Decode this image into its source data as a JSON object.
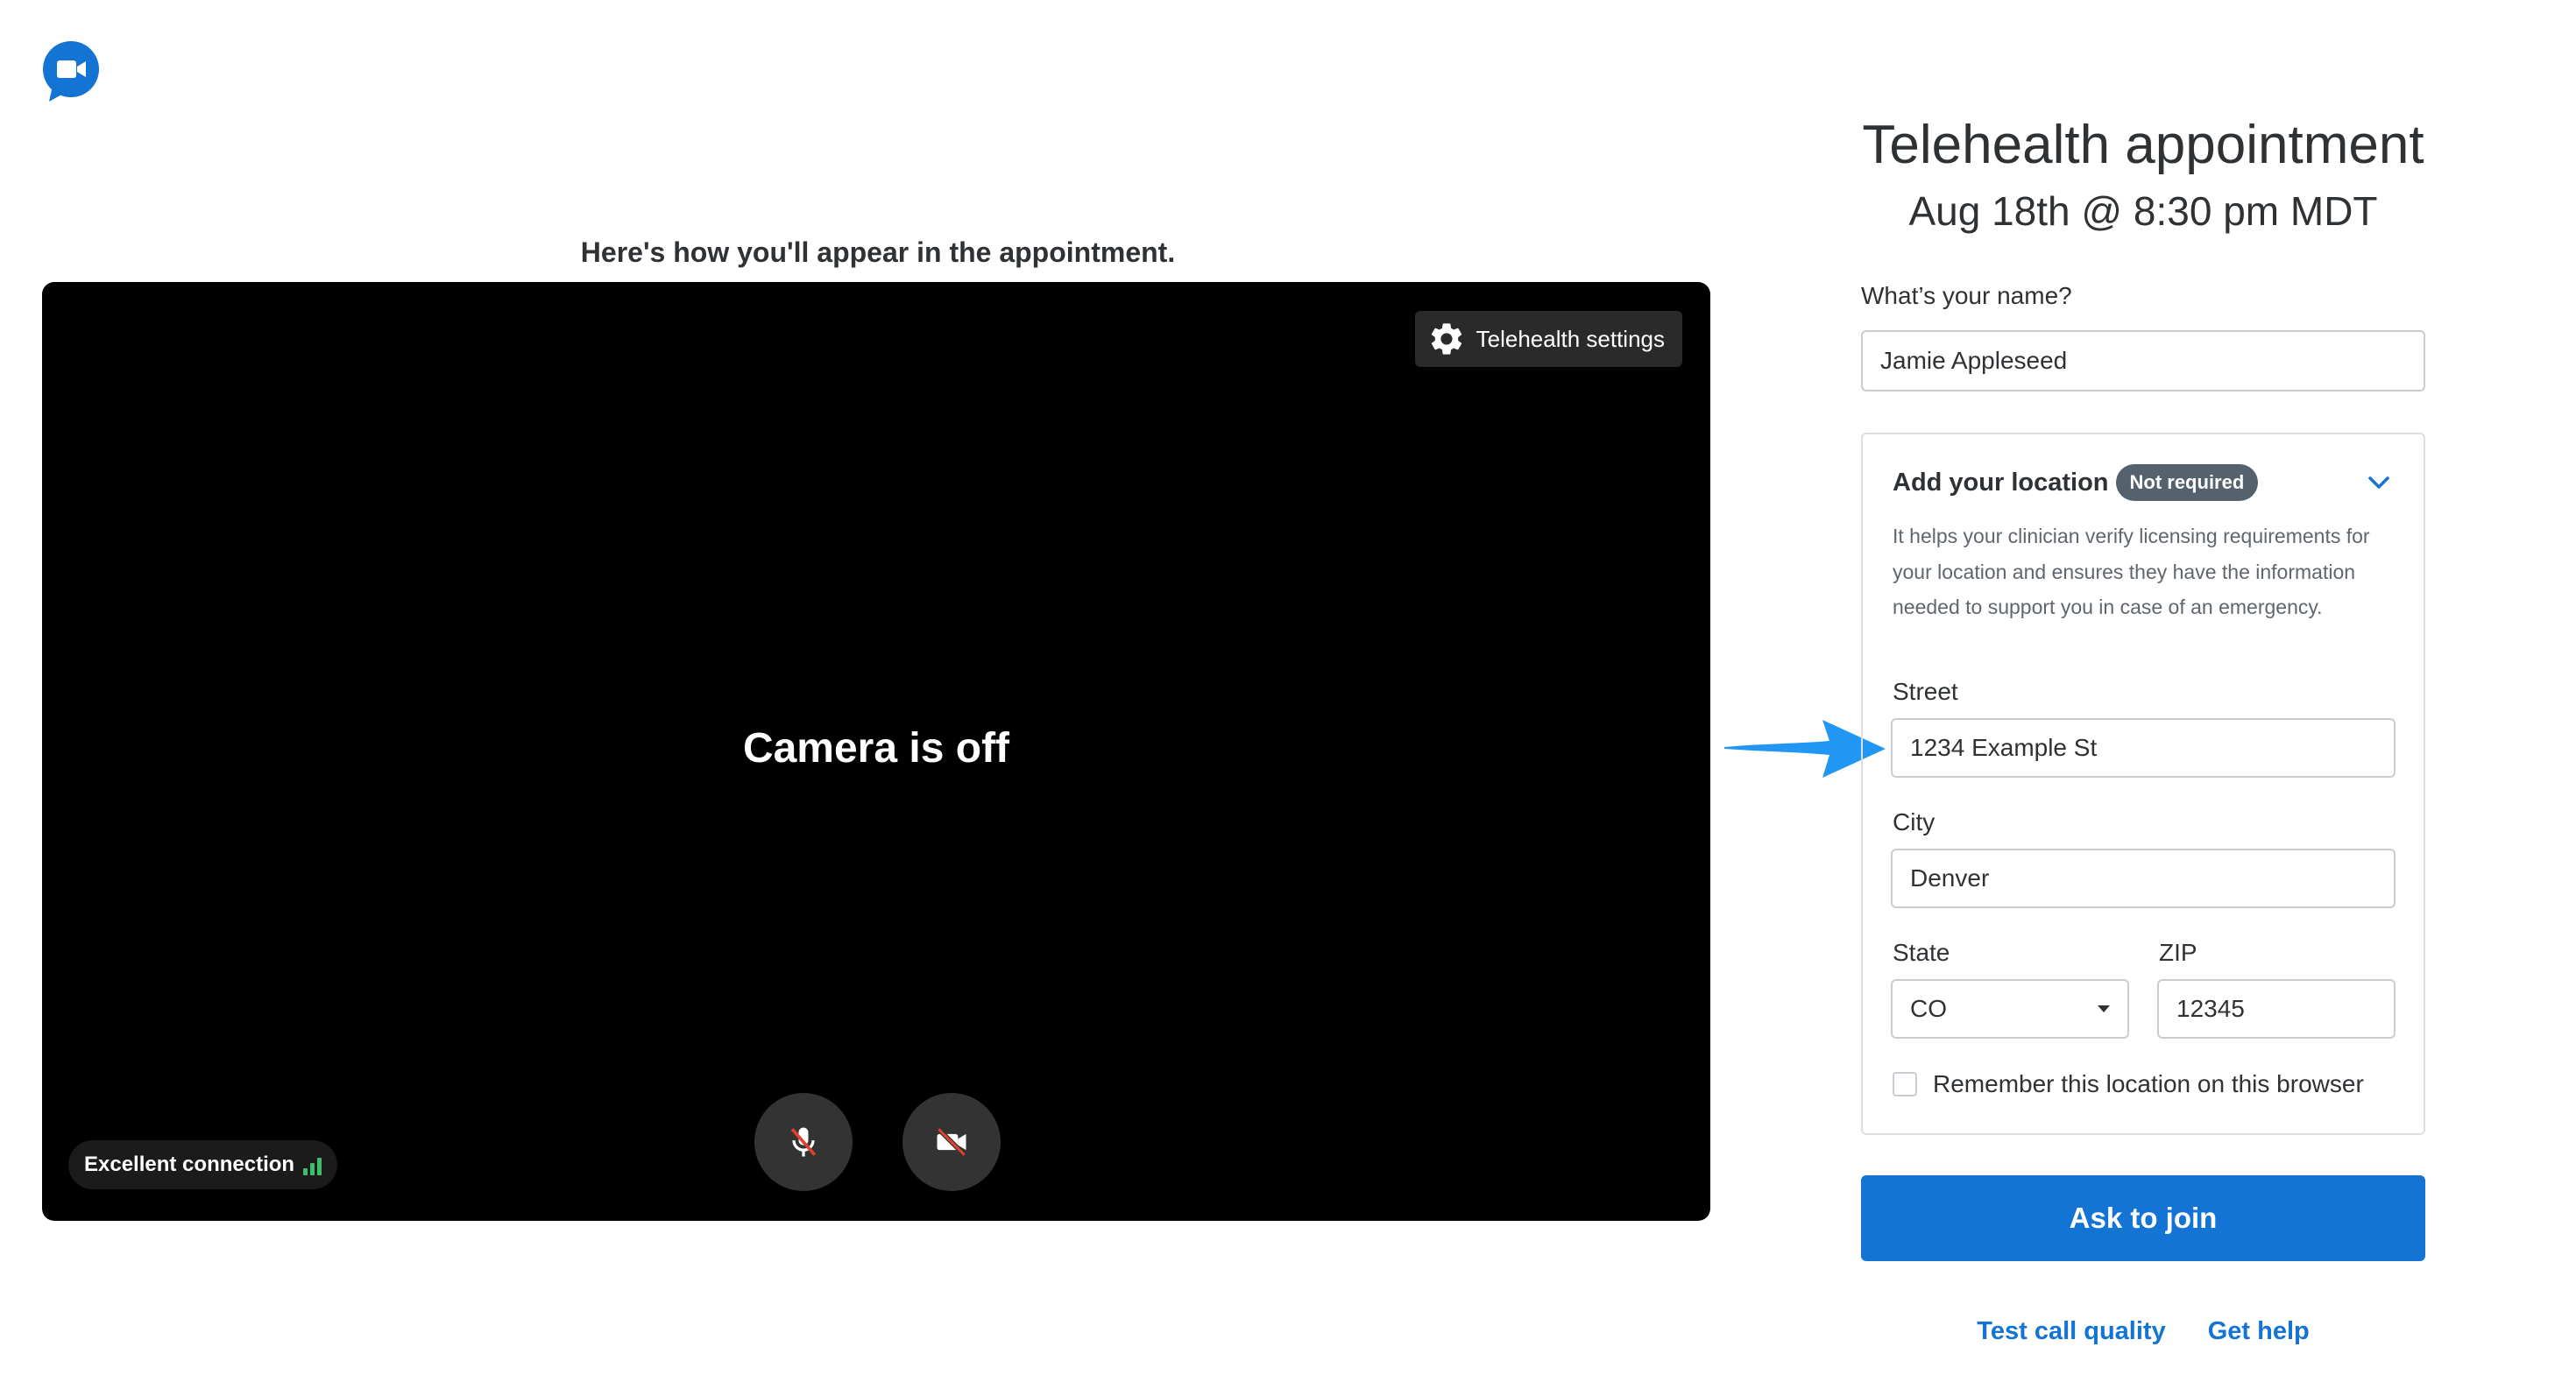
{
  "logo": {
    "icon": "video-chat-logo-icon",
    "color": "#1374d4"
  },
  "preview": {
    "caption": "Here's how you'll appear in the appointment.",
    "camera_status": "Camera is off",
    "settings_label": "Telehealth settings",
    "connection_label": "Excellent connection",
    "connection_color": "#3bbf6a",
    "mic_icon": "mic-off-icon",
    "camera_icon": "camera-off-icon"
  },
  "appointment": {
    "title": "Telehealth appointment",
    "datetime": "Aug 18th @ 8:30 pm MDT"
  },
  "form": {
    "name_label": "What’s your name?",
    "name_value": "Jamie Appleseed",
    "location": {
      "heading": "Add your location",
      "badge": "Not required",
      "description": "It helps your clinician verify licensing requirements for your location and ensures they have the information needed to support you in case of an emergency.",
      "street_label": "Street",
      "street_value": "1234 Example St",
      "city_label": "City",
      "city_value": "Denver",
      "state_label": "State",
      "state_value": "CO",
      "zip_label": "ZIP",
      "zip_value": "12345",
      "remember_label": "Remember this location on this browser"
    },
    "join_label": "Ask to join"
  },
  "links": {
    "test_call": "Test call quality",
    "help": "Get help"
  },
  "colors": {
    "accent": "#1374d4",
    "arrow": "#2196f3"
  }
}
